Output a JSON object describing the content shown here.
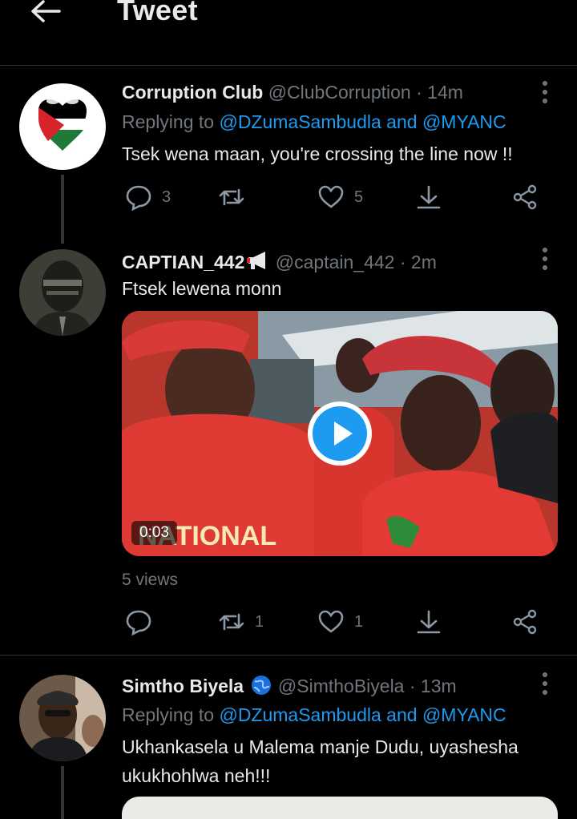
{
  "header": {
    "title": "Tweet"
  },
  "tweets": [
    {
      "name": "Corruption Club",
      "handle": "@ClubCorruption",
      "time": "· 14m",
      "replying_prefix": "Replying to",
      "mention": "@DZumaSambudla and @MYANC",
      "text": "Tsek wena maan, you're crossing the line now !!",
      "reply_count": "3",
      "retweet_count": "",
      "like_count": "5"
    },
    {
      "name": "CAPTIAN_442",
      "handle": "@captain_442",
      "time": "· 2m",
      "text": "Ftsek lewena monn",
      "video_duration": "0:03",
      "video_caption": "NATIONAL",
      "views": "5 views",
      "reply_count": "",
      "retweet_count": "1",
      "like_count": "1"
    },
    {
      "name": "Simtho Biyela",
      "handle": "@SimthoBiyela",
      "time": "· 13m",
      "replying_prefix": "Replying to",
      "mention": "@DZumaSambudla and @MYANC",
      "text_line1": "Ukhankasela u Malema manje Dudu, uyashesha",
      "text_line2": "ukukhohlwa neh!!!"
    }
  ],
  "colors": {
    "accent": "#1d9bf0",
    "muted": "#71767b",
    "text": "#e7e9ea",
    "background": "#000000"
  }
}
